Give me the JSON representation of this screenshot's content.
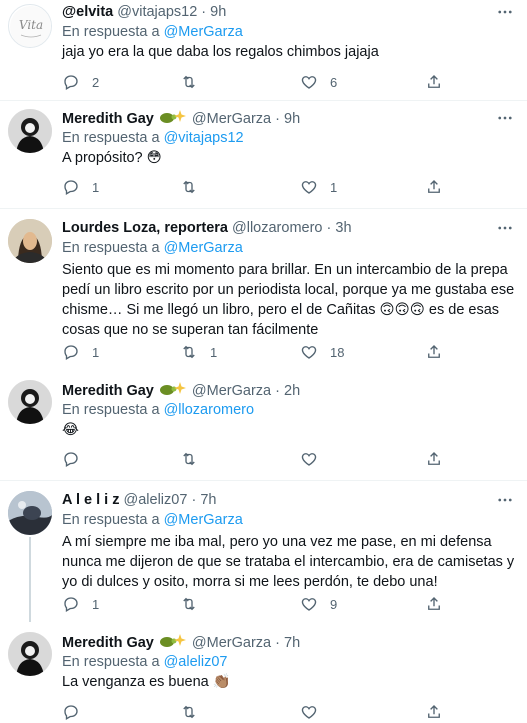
{
  "tweets": [
    {
      "name": "@elvita",
      "handle": "@vitajaps12",
      "dot": "·",
      "time": "9h",
      "reply_prefix": "En respuesta a ",
      "reply_to": "@MerGarza",
      "text": "jaja yo era la que daba los regalos chimbos jajaja",
      "replies": "2",
      "retweets": "",
      "likes": "6"
    },
    {
      "name": "Meredith Gay",
      "handle": "@MerGarza",
      "dot": "·",
      "time": "9h",
      "reply_prefix": "En respuesta a ",
      "reply_to": "@vitajaps12",
      "text": "A propósito? 😳",
      "replies": "1",
      "retweets": "",
      "likes": "1"
    },
    {
      "name": "Lourdes Loza, reportera",
      "handle": "@llozaromero",
      "dot": "·",
      "time": "3h",
      "reply_prefix": "En respuesta a ",
      "reply_to": "@MerGarza",
      "text": "Siento que es mi momento para brillar. En un intercambio de la prepa pedí un libro escrito por un periodista local, porque ya me gustaba ese chisme… Si me llegó un libro, pero el de Cañitas 🙃🙃🙃 es de esas cosas que no se superan tan fácilmente",
      "replies": "1",
      "retweets": "1",
      "likes": "18"
    },
    {
      "name": "Meredith Gay",
      "handle": "@MerGarza",
      "dot": "·",
      "time": "2h",
      "reply_prefix": "En respuesta a ",
      "reply_to": "@llozaromero",
      "text": "😂",
      "replies": "",
      "retweets": "",
      "likes": ""
    },
    {
      "name": "A l e l i z",
      "handle": "@aleliz07",
      "dot": "·",
      "time": "7h",
      "reply_prefix": "En respuesta a ",
      "reply_to": "@MerGarza",
      "text": "A mí siempre me iba mal, pero yo una vez me pase, en mi defensa nunca me dijeron de que se trataba el intercambio, era de camisetas y yo di dulces y osito, morra si me lees perdón, te debo una!",
      "replies": "1",
      "retweets": "",
      "likes": "9"
    },
    {
      "name": "Meredith Gay",
      "handle": "@MerGarza",
      "dot": "·",
      "time": "7h",
      "reply_prefix": "En respuesta a ",
      "reply_to": "@aleliz07",
      "text": "La venganza es buena 👏🏽",
      "replies": "",
      "retweets": "",
      "likes": ""
    }
  ],
  "avatar_text": "Vita",
  "icons": {
    "reply": "reply-icon",
    "retweet": "retweet-icon",
    "like": "heart-icon",
    "share": "share-icon",
    "more": "more-icon",
    "badge": "turtle-sparkle-icon"
  },
  "colors": {
    "accent": "#1d9bf0",
    "secondary_text": "#536471",
    "thread_line": "#cfd9de",
    "divider": "#eff3f4"
  }
}
